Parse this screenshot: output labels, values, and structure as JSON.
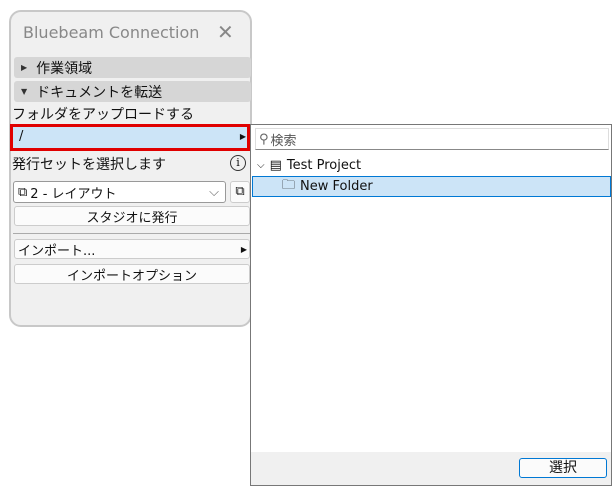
{
  "panel": {
    "title": "Bluebeam Connection",
    "sections": [
      {
        "label": "作業領域",
        "expanded": false
      },
      {
        "label": "ドキュメントを転送",
        "expanded": true
      }
    ],
    "upload_label": "フォルダをアップロードする",
    "folder_path": "/",
    "publish_set_label": "発行セットを選択します",
    "publish_set_value": "2 - レイアウト",
    "publish_button": "スタジオに発行",
    "import_label": "インポート...",
    "import_options_button": "インポートオプション"
  },
  "popup": {
    "search_placeholder": "検索",
    "tree": [
      {
        "label": "Test Project",
        "expanded": true
      },
      {
        "label": "New Folder",
        "selected": true
      }
    ],
    "select_button": "選択"
  },
  "colors": {
    "highlight": "#cce4f7",
    "focus": "#e00000",
    "accent": "#0078d4"
  }
}
